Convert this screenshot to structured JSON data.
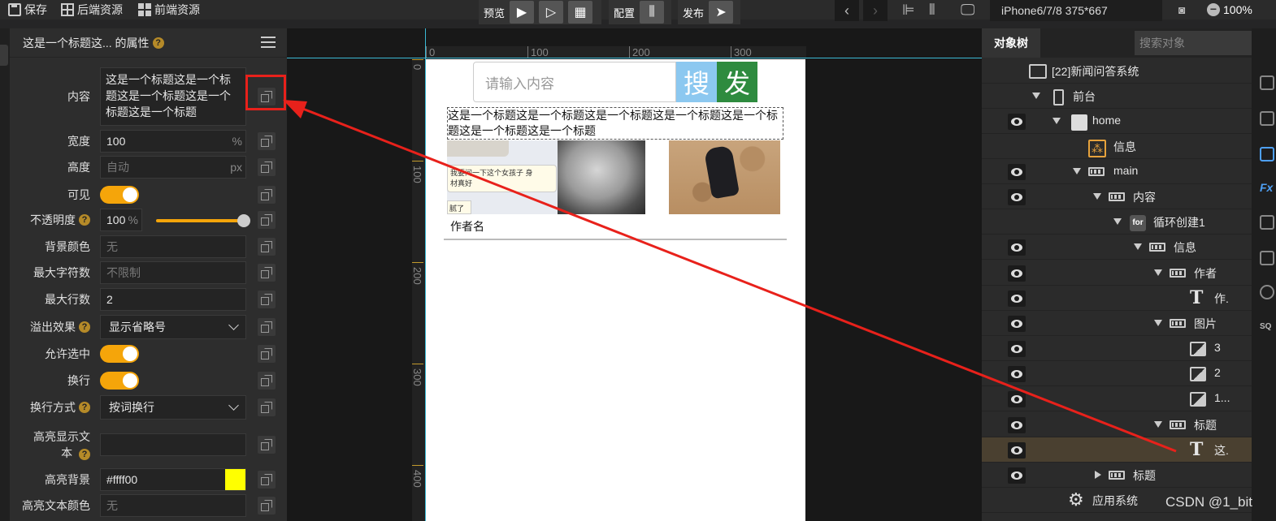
{
  "toolbar": {
    "save_label": "保存",
    "backend_label": "后端资源",
    "frontend_label": "前端资源",
    "preview_label": "预览",
    "config_label": "配置",
    "publish_label": "发布",
    "device": "iPhone6/7/8 375*667",
    "zoom": "100%"
  },
  "props": {
    "title": "这是一个标题这... 的属性",
    "help_mark": "?",
    "rows": {
      "content": {
        "label": "内容",
        "value": "这是一个标题这是一个标题这是一个标题这是一个标题这是一个标题"
      },
      "width": {
        "label": "宽度",
        "value": "100",
        "unit": "%"
      },
      "height": {
        "label": "高度",
        "placeholder": "自动",
        "unit": "px"
      },
      "visible": {
        "label": "可见",
        "on": true
      },
      "opacity": {
        "label": "不透明度",
        "value": "100",
        "unit": "%",
        "level_percent": 100
      },
      "bg_color": {
        "label": "背景颜色",
        "placeholder": "无"
      },
      "max_chars": {
        "label": "最大字符数",
        "placeholder": "不限制"
      },
      "max_lines": {
        "label": "最大行数",
        "value": "2"
      },
      "overflow": {
        "label": "溢出效果",
        "value": "显示省略号"
      },
      "selectable": {
        "label": "允许选中",
        "on": true
      },
      "wrap": {
        "label": "换行",
        "on": true
      },
      "wrap_mode": {
        "label": "换行方式",
        "value": "按词换行"
      },
      "highlight_text": {
        "label_line1": "高亮显示文",
        "label_line2": "本",
        "value": ""
      },
      "highlight_bg": {
        "label": "高亮背景",
        "value": "#ffff00",
        "swatch_color": "#ffff00"
      },
      "highlight_color": {
        "label": "高亮文本颜色",
        "placeholder": "无"
      }
    }
  },
  "ruler": {
    "top": [
      "0",
      "100",
      "200",
      "300"
    ],
    "left": [
      "0",
      "100",
      "200",
      "300",
      "400"
    ]
  },
  "phone": {
    "search_placeholder": "请输入内容",
    "search_btn": "搜",
    "post_btn": "发",
    "title_text": "这是一个标题这是一个标题这是一个标题这是一个标题这是一个标题这是一个标题这是一个标题",
    "thumb1_lines": [
      "我要问一下这个女孩子 身",
      "材真好",
      "腻了"
    ],
    "author_name": "作者名"
  },
  "tree": {
    "tab_label": "对象树",
    "search_placeholder": "搜索对象",
    "nodes": [
      {
        "label": "[22]新闻问答系统",
        "icon": "system-icon"
      },
      {
        "label": "前台",
        "icon": "phone-icon"
      },
      {
        "label": "home",
        "icon": "page-icon"
      },
      {
        "label": "信息",
        "icon": "info-icon"
      },
      {
        "label": "main",
        "icon": "box-icon"
      },
      {
        "label": "内容",
        "icon": "box-icon"
      },
      {
        "label": "循环创建1",
        "icon": "for-icon",
        "icon_text": "for"
      },
      {
        "label": "信息",
        "icon": "box-icon"
      },
      {
        "label": "作者",
        "icon": "box-icon"
      },
      {
        "label": "作.",
        "icon": "text-icon",
        "icon_text": "T"
      },
      {
        "label": "图片",
        "icon": "box-icon"
      },
      {
        "label": "3",
        "icon": "image-icon"
      },
      {
        "label": "2",
        "icon": "image-icon"
      },
      {
        "label": "1...",
        "icon": "image-icon"
      },
      {
        "label": "标题",
        "icon": "box-icon"
      },
      {
        "label": "这.",
        "icon": "text-icon",
        "icon_text": "T"
      },
      {
        "label": "标题",
        "icon": "box-icon"
      },
      {
        "label": "应用系统",
        "icon": "gear-icon"
      }
    ]
  },
  "right_strip": {
    "fx": "Fx",
    "sql": "SQ"
  },
  "watermark": "CSDN @1_bit",
  "colors": {
    "accent": "#f5a50a",
    "annotation": "#e8211b",
    "search_btn": "#8cc8f0",
    "post_btn": "#2e8b3f"
  }
}
